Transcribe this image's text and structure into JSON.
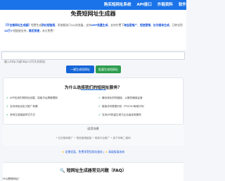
{
  "nav": {
    "items": [
      "购买短网址系统",
      "API接口",
      "外链资料",
      "软件"
    ]
  },
  "hero": {
    "title": "免费短网址生成器",
    "desc_parts": [
      {
        "t": "【不会看网址生成器】",
        "hl": true
      },
      {
        "t": "免费生成",
        "hl": false
      },
      {
        "t": "防红短链接",
        "hl": true
      },
      {
        "t": "，系统服务只QQ浏览器，支持",
        "hl": false
      },
      {
        "t": "APP批量生成",
        "hl": true
      },
      {
        "t": "，支持付费下",
        "hl": false
      },
      {
        "t": "淘宝客推广、短信营销、社交媒体生成",
        "hl": true
      },
      {
        "t": "。已转化到",
        "hl": false
      },
      {
        "t": "10万+",
        "hl": true
      },
      {
        "t": "短链接支持，",
        "hl": false
      },
      {
        "t": "稳定高速",
        "hl": true
      },
      {
        "t": "，永久免费！",
        "hl": false
      }
    ]
  },
  "input": {
    "placeholder": "输入http://或https://开头的网址"
  },
  "buttons": {
    "generate": "一键生成短网址",
    "clear": "批量生成短网址"
  },
  "why": {
    "title": "为什么选择我们的短网址服务？",
    "features": [
      "APP应用内短网址创建，突破平台屏蔽限制",
      "支持添加自定义推广标题",
      "多种生成链接样式方式",
      "最标准化的短链接，以服务器保证速",
      "链接访问数据分析（PV/UV/地域分布）",
      "支持API批量生成与企业级定制服务"
    ]
  },
  "apps": {
    "title": "适用场景",
    "items": [
      "社交媒体推广",
      "短信营销链接",
      "电商平台推广",
      "线下印刷二维码"
    ]
  },
  "promo": {
    "text": "定期优惠，免费享受短网址服务",
    "link": "高级版请咨询"
  },
  "faq": {
    "title": "短网址生成器常见问题（FAQ）",
    "q1": "什么是短网址？"
  }
}
